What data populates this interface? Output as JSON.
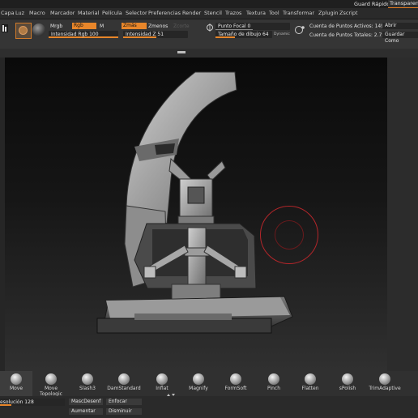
{
  "top": {
    "quick_save": "Guard Rápido",
    "transparent": "Transparente"
  },
  "menu": [
    "Capa",
    "Luz",
    "Macro",
    "Marcador",
    "Material",
    "Película",
    "Selector",
    "Preferencias",
    "Render",
    "Stencil",
    "Trazos",
    "Textura",
    "Tool",
    "Transformar",
    "Zplugin",
    "Zscript"
  ],
  "toolbar": {
    "mrgb": "Mrgb",
    "rgb": "Rgb",
    "m": "M",
    "zadd": "Zmás",
    "zsub": "Zmenos",
    "zcut": "Zcorte",
    "rgb_intensity": "Intensidad Rgb 100",
    "z_intensity": "Intensidad Z 51",
    "focal": "Punto Focal 0",
    "draw_size": "Tamaño de dibujo 64",
    "dynamic": "Dynamic",
    "active_points": "Cuenta de Puntos Activos: 149,28",
    "total_points": "Cuenta de Puntos Totales: 2.754,1",
    "open": "Abrir",
    "save_as": "Guardar Como"
  },
  "brushes": [
    {
      "label": "Move"
    },
    {
      "label": "Move Topologic"
    },
    {
      "label": "Slash3"
    },
    {
      "label": "DamStandard"
    },
    {
      "label": "Inflat"
    },
    {
      "label": "Magnify"
    },
    {
      "label": "FormSoft"
    },
    {
      "label": "Pinch"
    },
    {
      "label": "Flatten"
    },
    {
      "label": "sPolish"
    },
    {
      "label": "TrimAdaptive"
    }
  ],
  "bottom": {
    "resolution": "esolución 128",
    "mask_blur": "MascDesenf",
    "focus": "Enfocar",
    "increase": "Aumentar",
    "decrease": "Disminuir"
  },
  "colors": {
    "accent": "#e8862a",
    "cursor": "#b3262a"
  }
}
